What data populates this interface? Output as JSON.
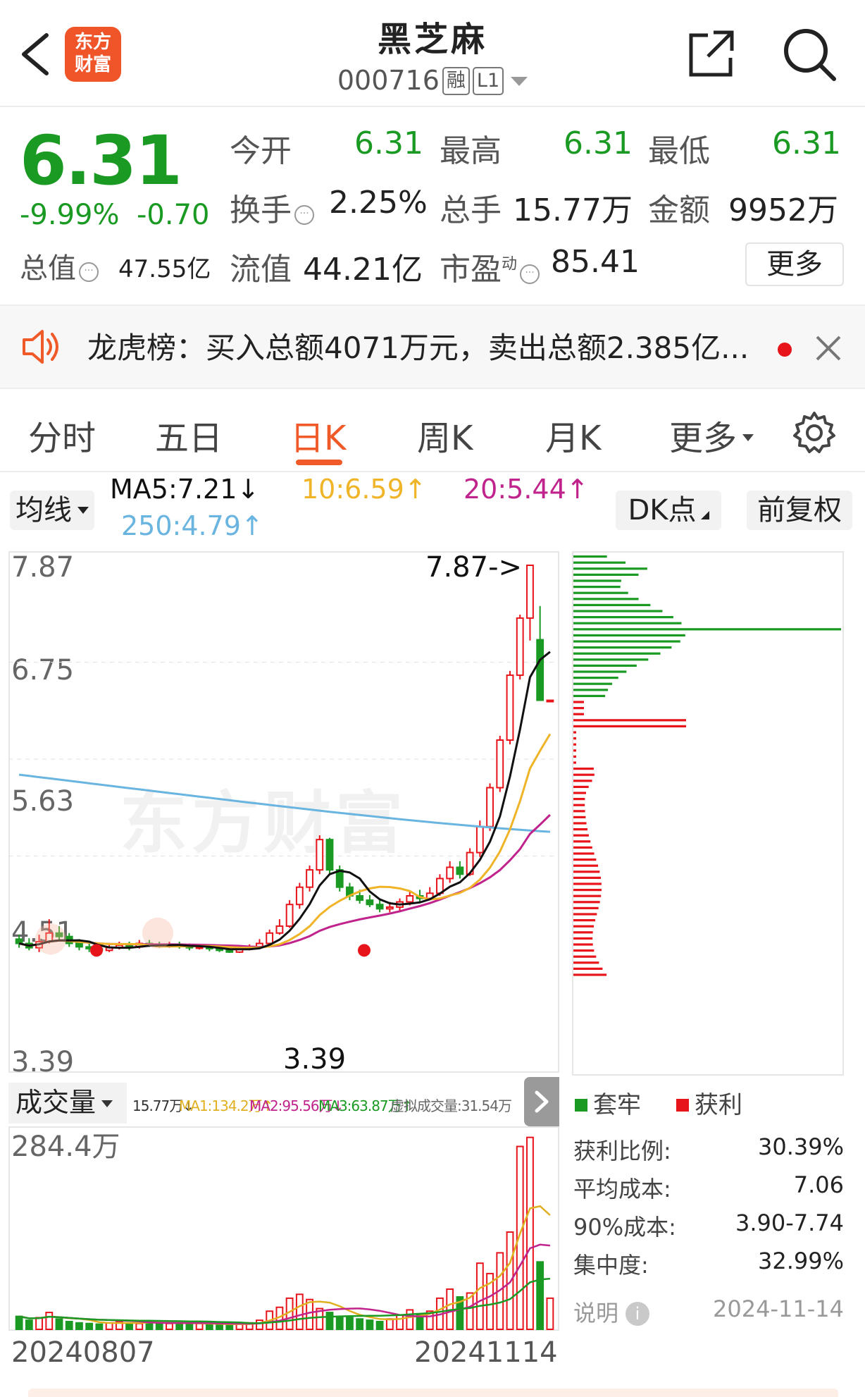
{
  "header": {
    "logo_line1": "东方",
    "logo_line2": "财富",
    "name": "黑芝麻",
    "code": "000716",
    "tag_margin": "融",
    "tag_level": "L1"
  },
  "quote": {
    "price": "6.31",
    "change_pct": "-9.99%",
    "change_abs": "-0.70",
    "open_label": "今开",
    "open_value": "6.31",
    "high_label": "最高",
    "high_value": "6.31",
    "low_label": "最低",
    "low_value": "6.31",
    "turnover_label": "换手",
    "turnover_value": "2.25%",
    "volume_label": "总手",
    "volume_value": "15.77万",
    "amount_label": "金额",
    "amount_value": "9952万",
    "mktcap_label": "总值",
    "mktcap_value": "47.55亿",
    "float_label": "流值",
    "float_value": "44.21亿",
    "pe_label": "市盈",
    "pe_sup": "动",
    "pe_value": "85.41",
    "more_label": "更多"
  },
  "notice": {
    "text": "龙虎榜：买入总额4071万元，卖出总额2.385亿..."
  },
  "tabs": [
    {
      "label": "分时"
    },
    {
      "label": "五日"
    },
    {
      "label": "日K"
    },
    {
      "label": "周K"
    },
    {
      "label": "月K"
    },
    {
      "label": "更多"
    }
  ],
  "active_tab": "日K",
  "ma_row": {
    "selector_label": "均线",
    "ma5": "MA5:7.21↓",
    "ma10": "10:6.59↑",
    "ma20": "20:5.44↑",
    "ma250": "250:4.79↑",
    "dk_label": "DK点",
    "adjust_label": "前复权"
  },
  "kline": {
    "y_labels": [
      "7.87",
      "6.75",
      "5.63",
      "4.51",
      "3.39"
    ],
    "high_marker": "7.87->",
    "low_marker": "3.39",
    "watermark": "东方财富"
  },
  "volume": {
    "selector_label": "成交量",
    "vol": "15.77万↓",
    "ma1": "MA1:134.2万↑",
    "ma2": "MA2:95.56万↓",
    "ma3": "MA3:63.87万↑",
    "virtual": "虚拟成交量:31.54万",
    "max_label": "284.4万"
  },
  "dates": {
    "start": "20240807",
    "end": "20241114"
  },
  "chips": {
    "legend_trapped": "套牢",
    "legend_profit": "获利",
    "stats": [
      {
        "label": "获利比例:",
        "value": "30.39%"
      },
      {
        "label": "平均成本:",
        "value": "7.06"
      },
      {
        "label": "90%成本:",
        "value": "3.90-7.74"
      },
      {
        "label": "集中度:",
        "value": "32.99%"
      }
    ],
    "note_label": "说明",
    "date": "2024-11-14"
  },
  "colors": {
    "up": "#e8141b",
    "down": "#1a9a23",
    "accent": "#f05a28",
    "ma5": "#111111",
    "ma10": "#f0b428",
    "ma20": "#c0248c",
    "ma250": "#6ab4e0"
  }
}
